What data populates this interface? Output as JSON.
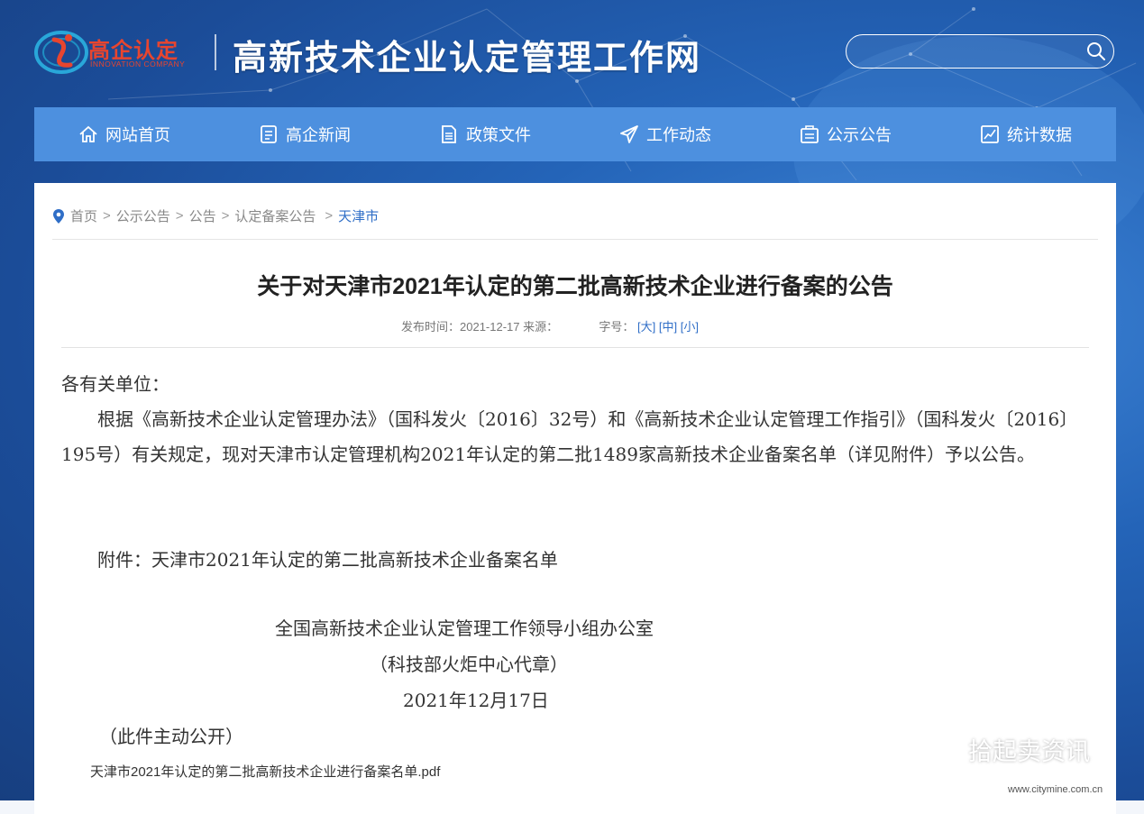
{
  "header": {
    "logo_text": "高企认定",
    "logo_sub": "INNOVATION COMPANY",
    "site_title": "高新技术企业认定管理工作网",
    "search": {
      "placeholder": ""
    }
  },
  "nav": {
    "items": [
      {
        "label": "网站首页",
        "icon": "home-icon"
      },
      {
        "label": "高企新闻",
        "icon": "news-icon"
      },
      {
        "label": "政策文件",
        "icon": "document-icon"
      },
      {
        "label": "工作动态",
        "icon": "paper-plane-icon"
      },
      {
        "label": "公示公告",
        "icon": "notice-icon"
      },
      {
        "label": "统计数据",
        "icon": "chart-icon"
      }
    ]
  },
  "breadcrumb": {
    "items": [
      "首页",
      "公示公告",
      "公告",
      "认定备案公告"
    ],
    "current": "天津市"
  },
  "article": {
    "title": "关于对天津市2021年认定的第二批高新技术企业进行备案的公告",
    "meta_label": "发布时间：2021-12-17 来源：",
    "font_label": "字号：",
    "font_sizes": [
      "[大]",
      "[中]",
      "[小]"
    ],
    "salutation": "各有关单位：",
    "paragraph": "根据《高新技术企业认定管理办法》（国科发火〔2016〕32号）和《高新技术企业认定管理工作指引》（国科发火〔2016〕195号）有关规定，现对天津市认定管理机构2021年认定的第二批1489家高新技术企业备案名单（详见附件）予以公告。",
    "attachment": "附件：天津市2021年认定的第二批高新技术企业备案名单",
    "signature_org": "全国高新技术企业认定管理工作领导小组办公室",
    "signature_seal": "（科技部火炬中心代章）",
    "signature_date": "2021年12月17日",
    "public_note": "（此件主动公开）",
    "pdf_link": "天津市2021年认定的第二批高新技术企业进行备案名单.pdf"
  },
  "watermark": {
    "text": "拾起卖资讯",
    "url": "www.citymine.com.cn"
  }
}
